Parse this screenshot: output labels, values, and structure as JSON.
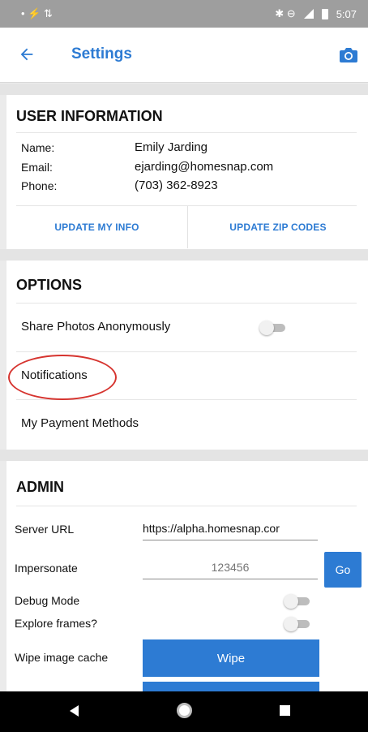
{
  "status_bar": {
    "left_glyphs": "• ⚡ ⇅",
    "right_glyphs": "✱ ⊖",
    "time": "5:07"
  },
  "app_bar": {
    "title": "Settings",
    "back_icon": "arrow-left-icon",
    "camera_icon": "camera-icon",
    "accent_color": "#2d7bd3"
  },
  "user_info": {
    "heading": "USER INFORMATION",
    "name_label": "Name:",
    "name_value": "Emily Jarding",
    "email_label": "Email:",
    "email_value": "ejarding@homesnap.com",
    "phone_label": "Phone:",
    "phone_value": "(703) 362-8923",
    "update_info_label": "UPDATE MY INFO",
    "update_zip_label": "UPDATE ZIP CODES"
  },
  "options": {
    "heading": "OPTIONS",
    "share_photos_label": "Share Photos Anonymously",
    "share_photos_on": false,
    "notifications_label": "Notifications",
    "payment_label": "My Payment Methods",
    "annotation_color": "#d6342f"
  },
  "admin": {
    "heading": "ADMIN",
    "server_url_label": "Server URL",
    "server_url_value": "https://alpha.homesnap.cor",
    "impersonate_label": "Impersonate",
    "impersonate_placeholder": "123456",
    "go_label": "Go",
    "debug_label": "Debug Mode",
    "debug_on": false,
    "explore_label": "Explore frames?",
    "explore_on": false,
    "wipe_label": "Wipe image cache",
    "wipe_button": "Wipe"
  },
  "nav_bar": {
    "back": "nav-back-icon",
    "home": "nav-home-icon",
    "recents": "nav-recents-icon"
  }
}
